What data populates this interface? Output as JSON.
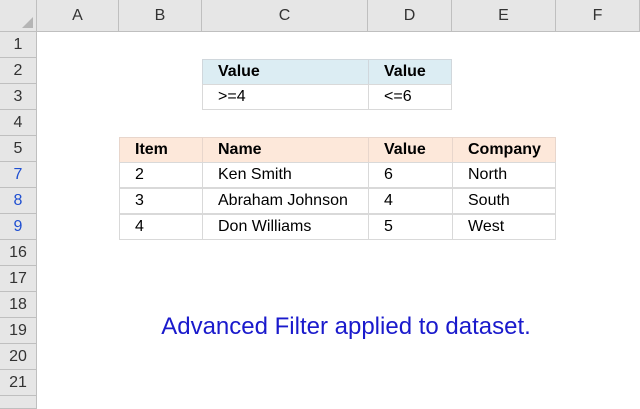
{
  "sheet": {
    "columns": [
      "A",
      "B",
      "C",
      "D",
      "E",
      "F"
    ],
    "rows": [
      "1",
      "2",
      "3",
      "4",
      "5",
      "7",
      "8",
      "9",
      "16",
      "17",
      "18",
      "19",
      "20",
      "21"
    ]
  },
  "criteria": {
    "headers": [
      "Value",
      "Value"
    ],
    "values": [
      ">=4",
      "<=6"
    ]
  },
  "table": {
    "headers": [
      "Item",
      "Name",
      "Value",
      "Company"
    ],
    "rows": [
      [
        "2",
        "Ken Smith",
        "6",
        "North"
      ],
      [
        "3",
        "Abraham Johnson",
        "4",
        "South"
      ],
      [
        "4",
        "Don Williams",
        "5",
        "West"
      ]
    ]
  },
  "note": "Advanced Filter applied to dataset.",
  "colors": {
    "criteria_header_bg": "#dcedf3",
    "table_header_bg": "#fde8da",
    "filtered_row_number": "#1f4fd1",
    "note_text": "#1a1acc"
  }
}
